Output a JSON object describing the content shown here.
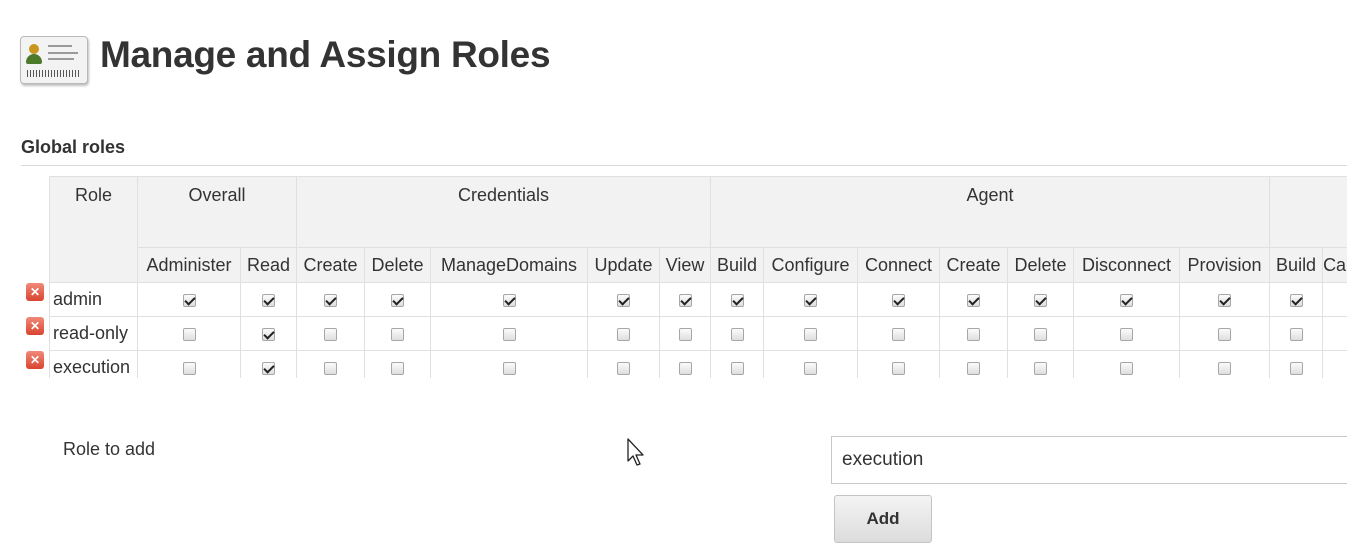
{
  "page": {
    "title": "Manage and Assign Roles",
    "icon": "id-card-icon"
  },
  "global_roles": {
    "section_title": "Global roles",
    "role_header": "Role",
    "groups": [
      {
        "label": "Overall",
        "span": 2
      },
      {
        "label": "Credentials",
        "span": 5
      },
      {
        "label": "Agent",
        "span": 7
      },
      {
        "label": "",
        "span": 2
      }
    ],
    "permissions": [
      "Administer",
      "Read",
      "Create",
      "Delete",
      "ManageDomains",
      "Update",
      "View",
      "Build",
      "Configure",
      "Connect",
      "Create",
      "Delete",
      "Disconnect",
      "Provision",
      "Build",
      "Ca"
    ],
    "rows": [
      {
        "name": "admin",
        "checked": [
          true,
          true,
          true,
          true,
          true,
          true,
          true,
          true,
          true,
          true,
          true,
          true,
          true,
          true,
          true,
          false
        ]
      },
      {
        "name": "read-only",
        "checked": [
          false,
          true,
          false,
          false,
          false,
          false,
          false,
          false,
          false,
          false,
          false,
          false,
          false,
          false,
          false,
          false
        ]
      },
      {
        "name": "execution",
        "checked": [
          false,
          true,
          false,
          false,
          false,
          false,
          false,
          false,
          false,
          false,
          false,
          false,
          false,
          false,
          false,
          false
        ]
      }
    ]
  },
  "add_role": {
    "label": "Role to add",
    "input_value": "execution",
    "button_label": "Add"
  },
  "colors": {
    "header_bg": "#f2f2f2",
    "delete_icon": "#d9442f",
    "border": "#e0e0e0"
  }
}
